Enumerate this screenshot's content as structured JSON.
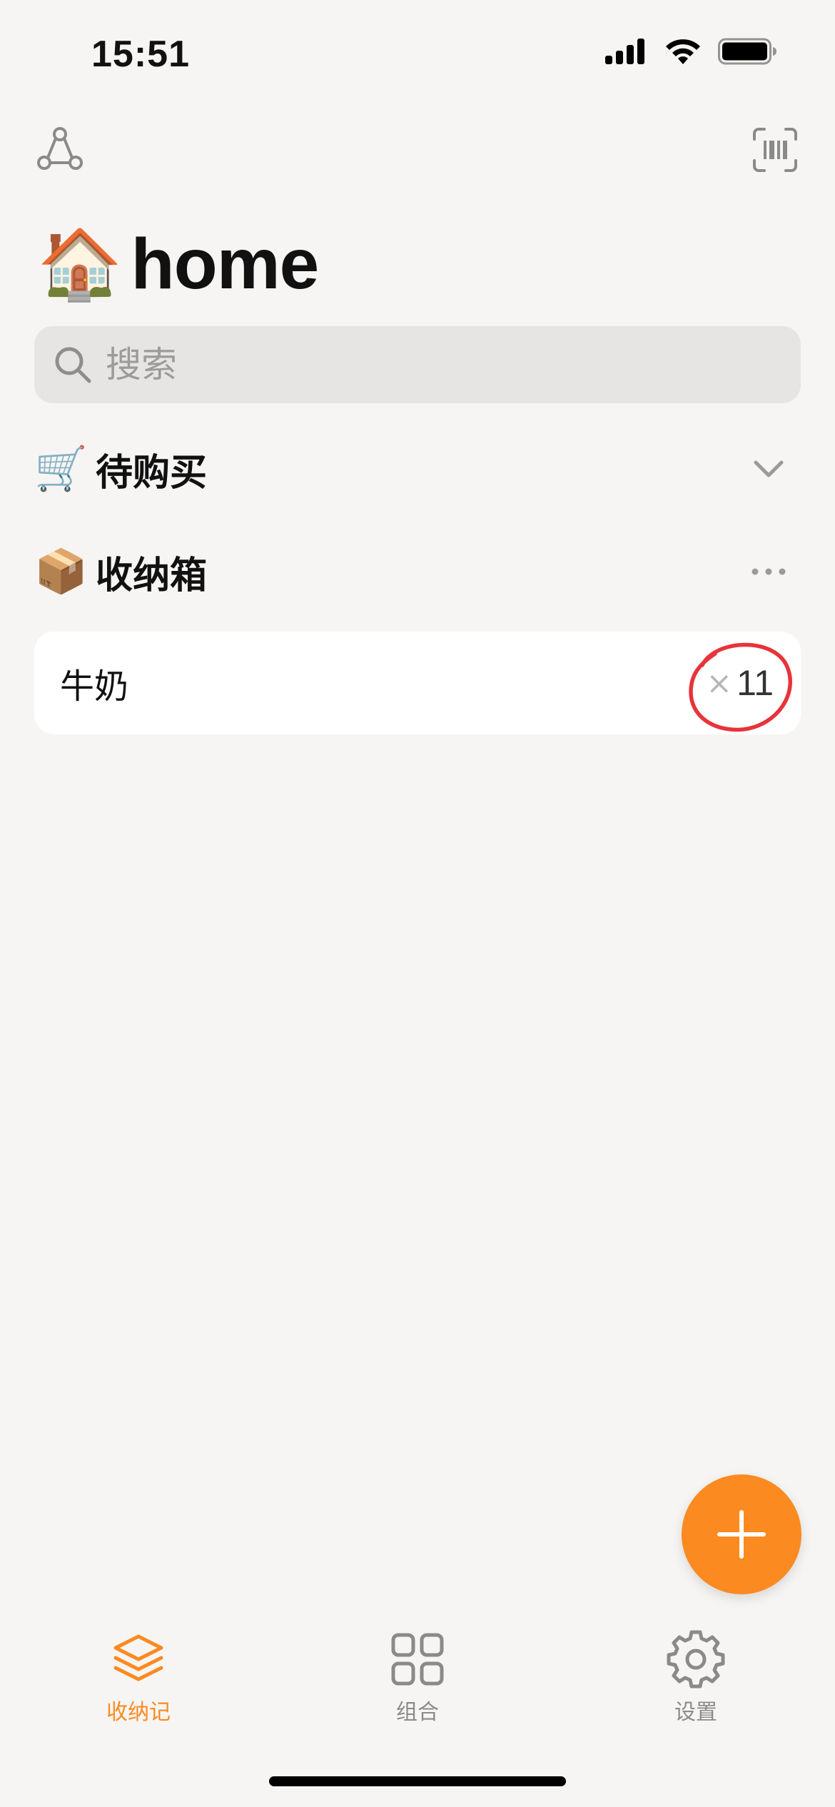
{
  "status_bar": {
    "time": "15:51",
    "icons": [
      "cellular-signal-icon",
      "wifi-icon",
      "battery-icon"
    ]
  },
  "header": {
    "left_icon": "share-icon",
    "right_icon": "barcode-scan-icon"
  },
  "title": {
    "emoji": "🏠",
    "text": "home"
  },
  "search": {
    "placeholder": "搜索",
    "value": ""
  },
  "sections": {
    "to_buy": {
      "emoji": "🛒",
      "label": "待购买",
      "action_icon": "chevron-down-icon"
    },
    "storage": {
      "emoji": "📦",
      "label": "收纳箱",
      "action_icon": "more-icon"
    }
  },
  "items": [
    {
      "name": "牛奶",
      "qty_prefix": "×",
      "qty": "11"
    }
  ],
  "fab": {
    "icon": "plus-icon"
  },
  "tabs": [
    {
      "label": "收纳记",
      "icon": "layers-icon",
      "active": true
    },
    {
      "label": "组合",
      "icon": "grid-icon",
      "active": false
    },
    {
      "label": "设置",
      "icon": "gear-icon",
      "active": false
    }
  ],
  "colors": {
    "accent": "#fb8a21",
    "background": "#f6f5f3",
    "search_bg": "#e6e5e3",
    "highlight": "#e8333a",
    "icon_gray": "#8a8a8a"
  }
}
